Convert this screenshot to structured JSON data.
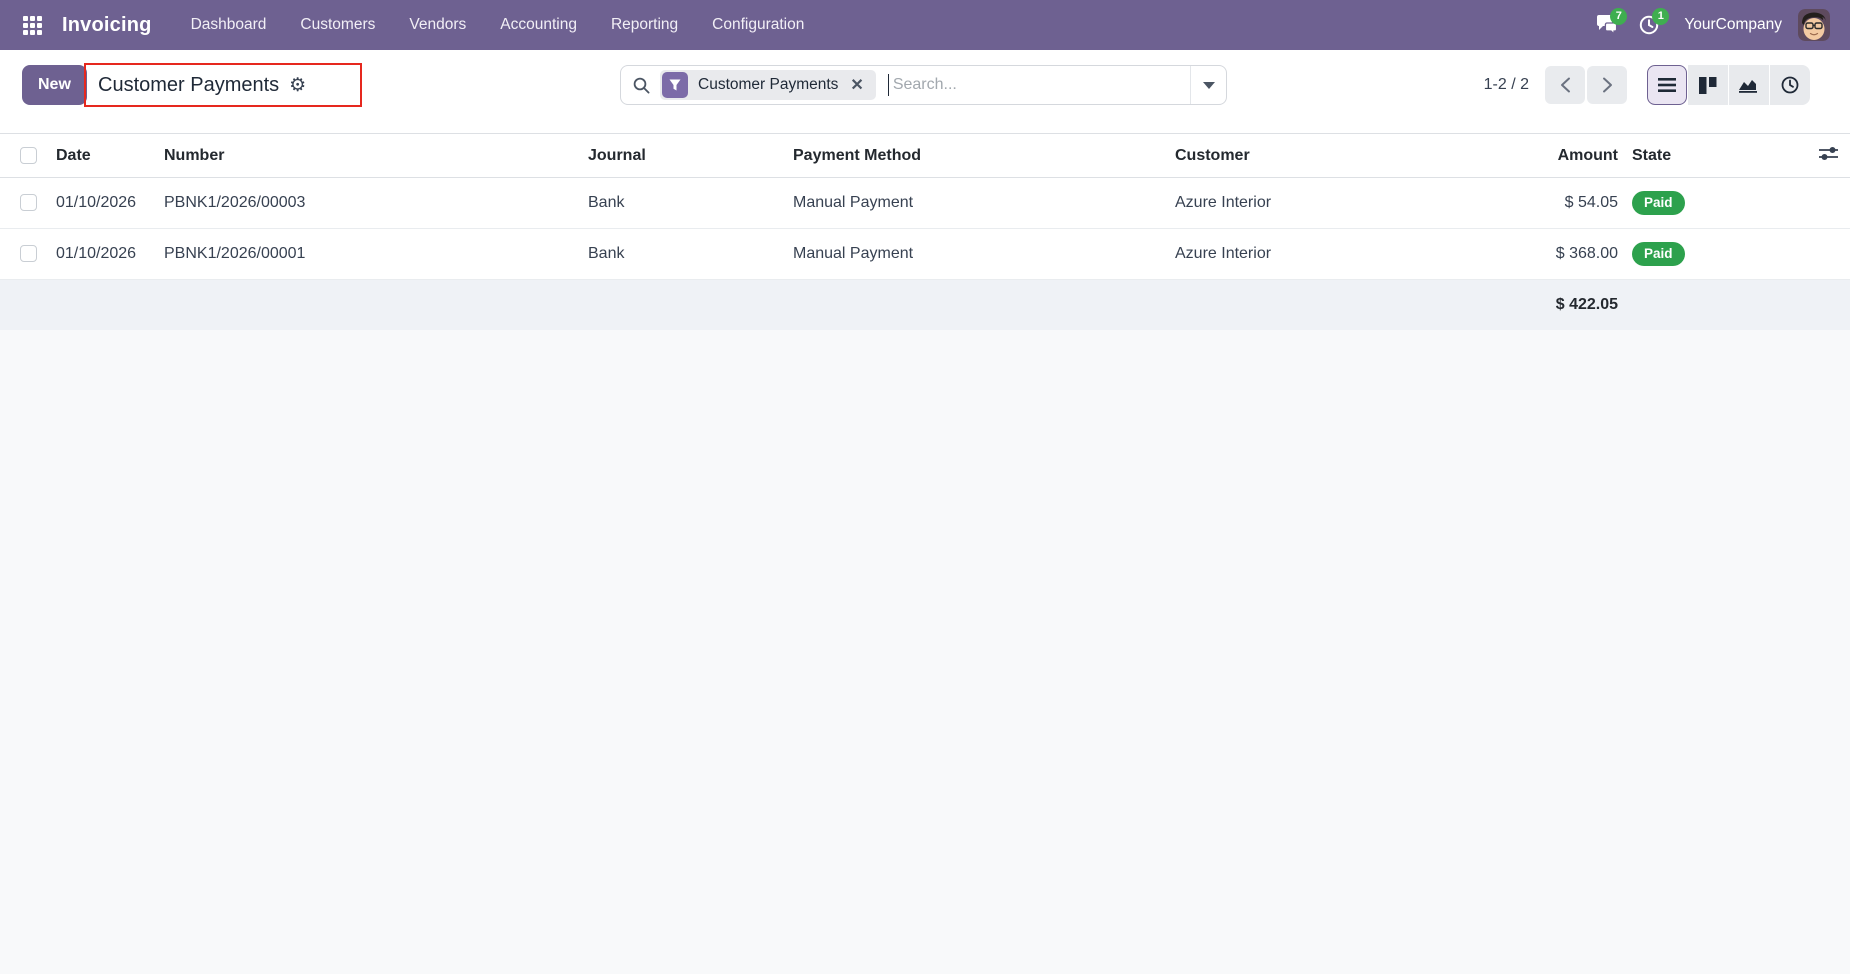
{
  "navbar": {
    "app_name": "Invoicing",
    "menu": [
      "Dashboard",
      "Customers",
      "Vendors",
      "Accounting",
      "Reporting",
      "Configuration"
    ],
    "messages_badge": "7",
    "activities_badge": "1",
    "company_name": "YourCompany"
  },
  "control_panel": {
    "new_button_label": "New",
    "breadcrumb_title": "Customer Payments",
    "gear_glyph": "⚙",
    "pager_text": "1-2 / 2"
  },
  "search": {
    "facet_label": "Customer Payments",
    "facet_remove_glyph": "✕",
    "placeholder": "Search..."
  },
  "table": {
    "columns": [
      "Date",
      "Number",
      "Journal",
      "Payment Method",
      "Customer",
      "Amount",
      "State"
    ],
    "rows": [
      {
        "date": "01/10/2026",
        "number": "PBNK1/2026/00003",
        "journal": "Bank",
        "payment_method": "Manual Payment",
        "customer": "Azure Interior",
        "amount": "$ 54.05",
        "state": "Paid"
      },
      {
        "date": "01/10/2026",
        "number": "PBNK1/2026/00001",
        "journal": "Bank",
        "payment_method": "Manual Payment",
        "customer": "Azure Interior",
        "amount": "$ 368.00",
        "state": "Paid"
      }
    ],
    "total_amount": "$ 422.05"
  },
  "colors": {
    "navbar_bg": "#6e6191",
    "primary_button": "#6e6191",
    "facet_icon_bg": "#7c6ba8",
    "paid_badge_green": "#2da14d",
    "notification_badge_green": "#3fae50",
    "highlight_box_red": "#e6281e",
    "footer_row_bg": "#eff2f6"
  }
}
